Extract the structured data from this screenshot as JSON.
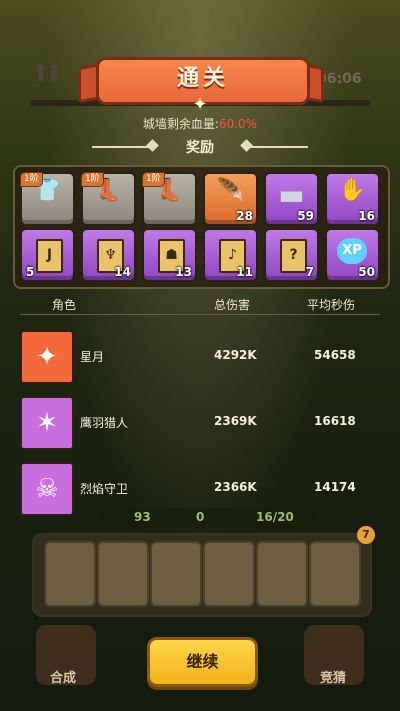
{
  "background": {
    "timer": "06:06",
    "pause_icon": "pause-icon"
  },
  "result": {
    "title": "通关",
    "wall_hp_label": "城墙剩余血量:",
    "wall_hp_value": "60.0%",
    "rewards_title": "奖励"
  },
  "rewards": [
    {
      "tier": "1阶",
      "icon": "armor-chest-icon",
      "style": "grey",
      "qty": ""
    },
    {
      "tier": "1阶",
      "icon": "boots-icon",
      "style": "grey",
      "qty": ""
    },
    {
      "tier": "1阶",
      "icon": "boots-icon",
      "style": "grey",
      "qty": ""
    },
    {
      "tier": "",
      "icon": "gold-feather-icon",
      "style": "orange",
      "qty": "28"
    },
    {
      "tier": "",
      "icon": "iron-ingot-icon",
      "style": "purple",
      "qty": "59"
    },
    {
      "tier": "",
      "icon": "glove-icon",
      "style": "purple",
      "qty": "16"
    },
    {
      "tier": "",
      "icon": "scroll-icon",
      "style": "purple",
      "qty": "5"
    },
    {
      "tier": "",
      "icon": "scroll-icon",
      "style": "purple",
      "qty": "14"
    },
    {
      "tier": "",
      "icon": "scroll-icon",
      "style": "purple",
      "qty": "13"
    },
    {
      "tier": "",
      "icon": "scroll-icon",
      "style": "purple",
      "qty": "11"
    },
    {
      "tier": "",
      "icon": "scroll-icon",
      "style": "purple",
      "qty": "7"
    },
    {
      "tier": "",
      "icon": "xp-icon",
      "style": "purple",
      "qty": "50",
      "badge_text": "XP"
    }
  ],
  "stats": {
    "headers": {
      "role": "角色",
      "total": "总伤害",
      "dps": "平均秒伤"
    },
    "rows": [
      {
        "name": "星月",
        "total": "4292K",
        "dps": "54658",
        "avatar_color": "#f26a3a"
      },
      {
        "name": "鹰羽猎人",
        "total": "2369K",
        "dps": "16618",
        "avatar_color": "#c86fe0"
      },
      {
        "name": "烈焰守卫",
        "total": "2366K",
        "dps": "14174",
        "avatar_color": "#c86fe0"
      }
    ]
  },
  "hud": {
    "res1": "93",
    "res2": "0",
    "res3": "16/20",
    "slot_count_badge": "7"
  },
  "buttons": {
    "continue": "继续",
    "merge": "合成",
    "guess": "竞猜"
  },
  "colors": {
    "accent_orange": "#e9683b",
    "hp_red": "#ff4c4c",
    "continue_yellow": "#f2b21c"
  }
}
